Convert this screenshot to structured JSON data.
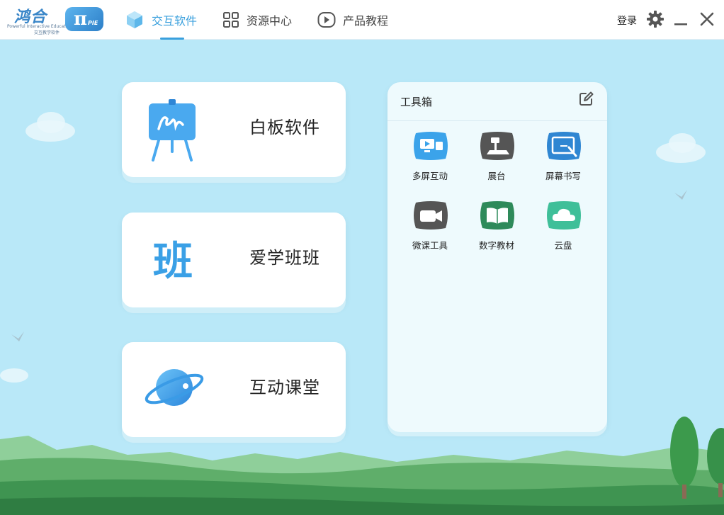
{
  "logo": {
    "name": "鸿合",
    "tagline_en": "Powerful Interactive Education",
    "tagline_cn": "交互教学软件",
    "badge_symbol": "π",
    "badge_text": "PIE"
  },
  "nav": {
    "tabs": [
      {
        "label": "交互软件",
        "icon": "cube-icon",
        "active": true
      },
      {
        "label": "资源中心",
        "icon": "grid-icon",
        "active": false
      },
      {
        "label": "产品教程",
        "icon": "play-icon",
        "active": false
      }
    ],
    "accent_color": "#3aa0dd"
  },
  "window": {
    "login_label": "登录"
  },
  "cards": [
    {
      "label": "白板软件",
      "icon": "whiteboard-easel-icon"
    },
    {
      "label": "爱学班班",
      "icon": "ban-character-icon",
      "glyph": "班"
    },
    {
      "label": "互动课堂",
      "icon": "planet-icon"
    }
  ],
  "toolbox": {
    "title": "工具箱",
    "items": [
      {
        "label": "多屏互动",
        "icon": "multi-screen-icon",
        "color": "#3ba3ea"
      },
      {
        "label": "展台",
        "icon": "document-camera-icon",
        "color": "#555555"
      },
      {
        "label": "屏幕书写",
        "icon": "screen-writing-icon",
        "color": "#2f86d2"
      },
      {
        "label": "微课工具",
        "icon": "video-camera-icon",
        "color": "#555555"
      },
      {
        "label": "数字教材",
        "icon": "open-book-icon",
        "color": "#2e8a5a"
      },
      {
        "label": "云盘",
        "icon": "cloud-icon",
        "color": "#3fbf99"
      }
    ]
  }
}
